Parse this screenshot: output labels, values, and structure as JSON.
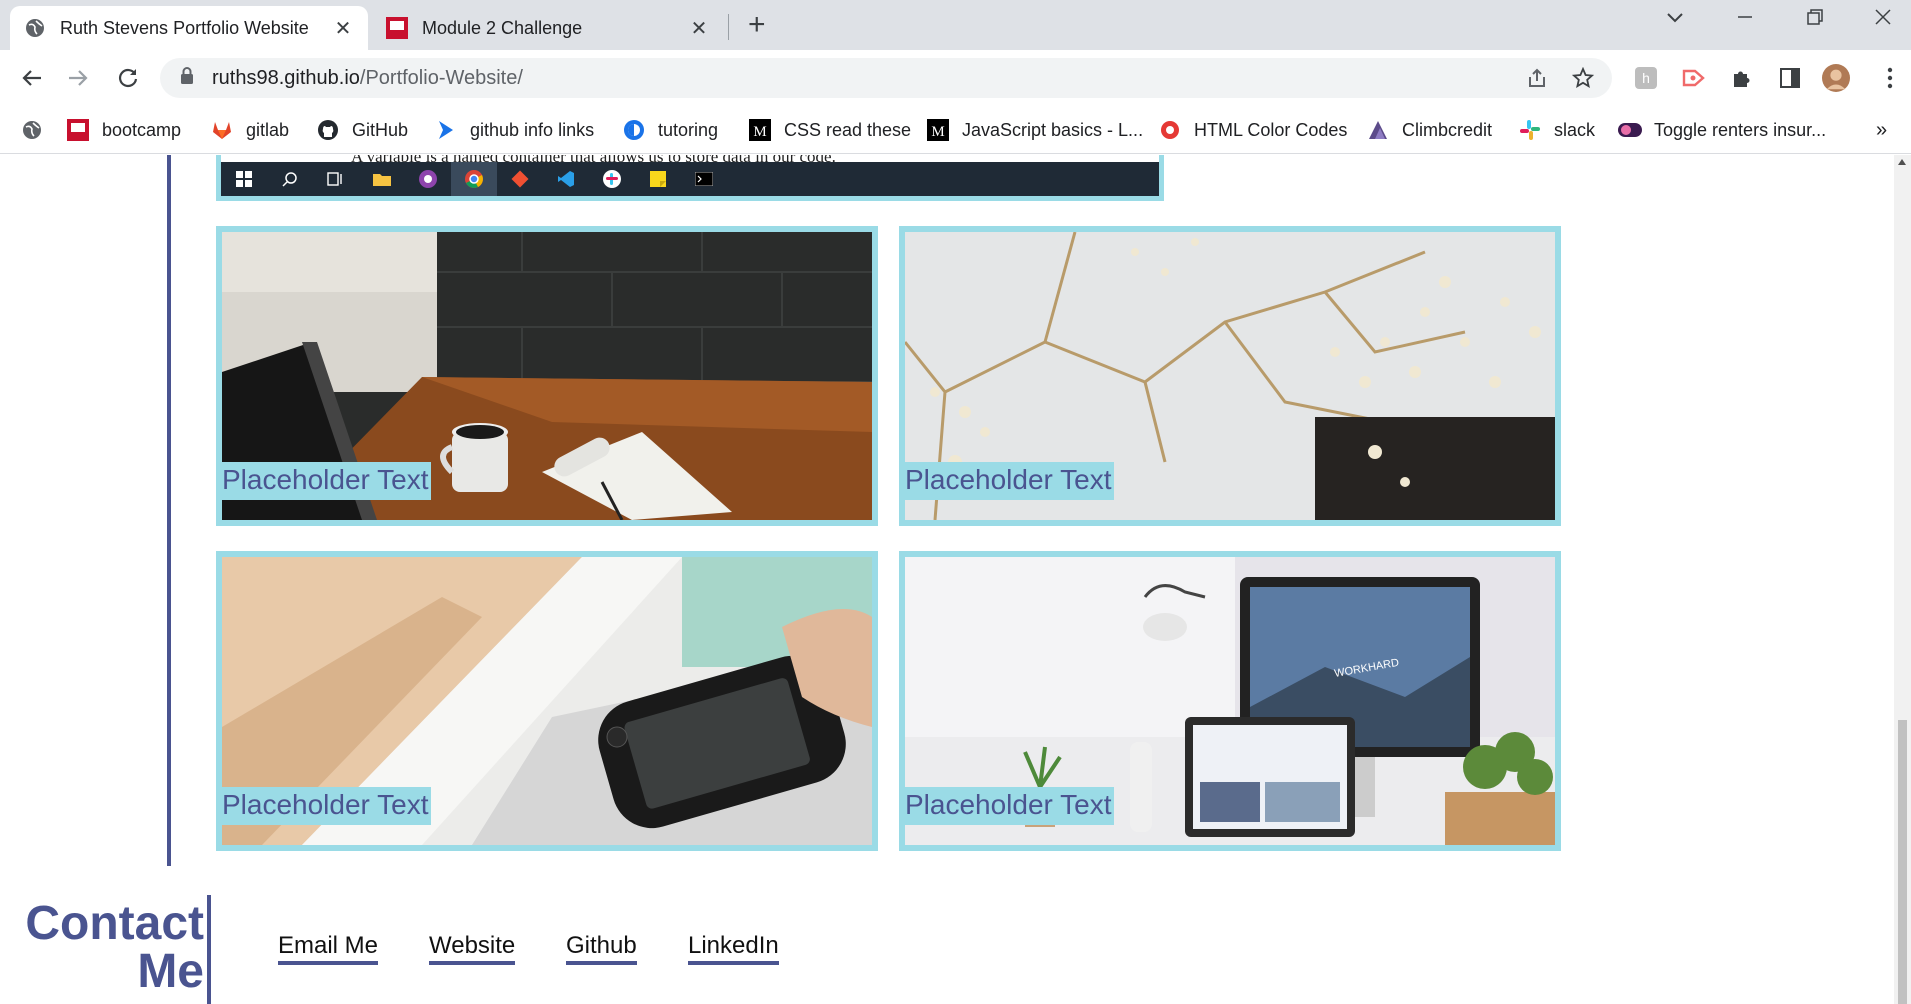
{
  "browser": {
    "tabs": [
      {
        "title": "Ruth Stevens Portfolio Website",
        "active": true
      },
      {
        "title": "Module 2 Challenge",
        "active": false
      }
    ],
    "url_host": "ruths98.github.io",
    "url_path": "/Portfolio-Website/",
    "bookmarks": [
      {
        "label": "bootcamp",
        "icon": "bootcamp-icon"
      },
      {
        "label": "gitlab",
        "icon": "gitlab-icon"
      },
      {
        "label": "GitHub",
        "icon": "github-icon"
      },
      {
        "label": "github info links",
        "icon": "arrow-icon"
      },
      {
        "label": "tutoring",
        "icon": "tutoring-icon"
      },
      {
        "label": "CSS read these",
        "icon": "medium-icon"
      },
      {
        "label": "JavaScript basics - L...",
        "icon": "medium-icon"
      },
      {
        "label": "HTML Color Codes",
        "icon": "color-icon"
      },
      {
        "label": "Climbcredit",
        "icon": "climbcredit-icon"
      },
      {
        "label": "slack",
        "icon": "slack-icon"
      },
      {
        "label": "Toggle renters insur...",
        "icon": "toggle-icon"
      }
    ]
  },
  "page": {
    "screenshot_text": "A variable is a named container that allows us to store data in our code.",
    "cards": [
      {
        "label": "Placeholder Text",
        "image": "desk-coffee-photo"
      },
      {
        "label": "Placeholder Text",
        "image": "flowers-marble-photo"
      },
      {
        "label": "Placeholder Text",
        "image": "psp-drawer-photo"
      },
      {
        "label": "Placeholder Text",
        "image": "workspace-monitor-photo"
      }
    ],
    "contact": {
      "title_line1": "Contact",
      "title_line2": "Me",
      "links": [
        "Email Me",
        "Website",
        "Github",
        "LinkedIn"
      ]
    }
  },
  "colors": {
    "accent": "#4a5490",
    "card_border": "#9adbe6"
  }
}
